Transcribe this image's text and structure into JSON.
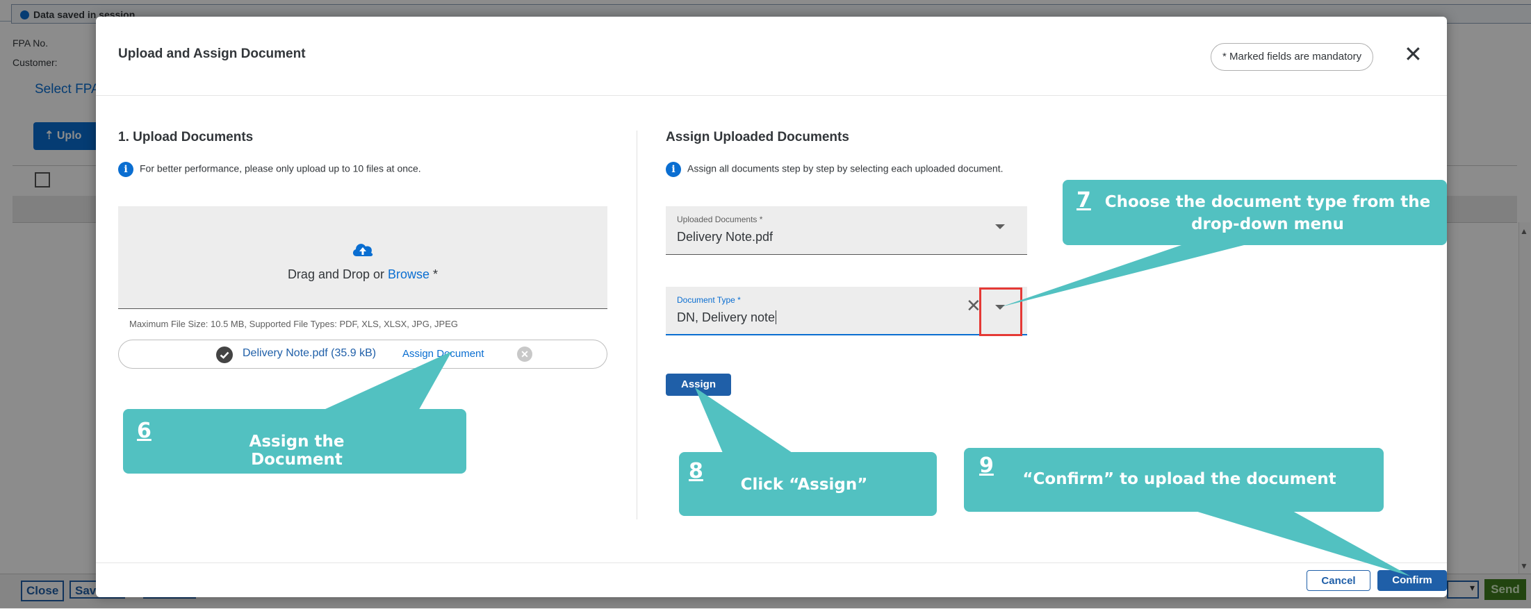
{
  "app": {
    "status_message": "Data saved in session",
    "fpa_label": "FPA No.",
    "customer_label": "Customer:",
    "select_fpa": "Select FPA",
    "upload_button": "Uplo",
    "close_button": "Close",
    "save_button": "Sav",
    "send_button": "Send"
  },
  "dialog": {
    "title": "Upload and Assign Document",
    "mandatory_note": "* Marked fields are mandatory",
    "close_icon": "close-icon"
  },
  "upload": {
    "title": "1. Upload Documents",
    "info": "For better performance, please only upload up to 10 files at once.",
    "drop_text": "Drag and Drop or ",
    "browse_link": "Browse",
    "required_mark": " *",
    "hint": "Maximum File Size: 10.5 MB, Supported File Types: PDF, XLS, XLSX, JPG, JPEG",
    "file_name": "Delivery Note.pdf (35.9 kB)",
    "assign_link": "Assign Document"
  },
  "assign": {
    "title": "Assign Uploaded Documents",
    "info": "Assign all documents step by step by selecting each uploaded document.",
    "uploaded_docs_label": "Uploaded Documents *",
    "uploaded_docs_value": "Delivery Note.pdf",
    "doc_type_label": "Document Type *",
    "doc_type_value": "DN, Delivery note",
    "assign_button": "Assign"
  },
  "footer": {
    "cancel_button": "Cancel",
    "confirm_button": "Confirm"
  },
  "callouts": {
    "step6": {
      "num": "6",
      "text": "Assign the Document"
    },
    "step7": {
      "num": "7",
      "text": "Choose the document type from the drop-down menu"
    },
    "step8": {
      "num": "8",
      "text": "Click “Assign”"
    },
    "step9": {
      "num": "9",
      "text": "“Confirm” to upload the document"
    }
  },
  "colors": {
    "accent": "#0a6ed1",
    "button": "#1f5fa8",
    "callout": "#52c1c1",
    "highlight": "#e53935",
    "send": "#3e7d1e"
  }
}
